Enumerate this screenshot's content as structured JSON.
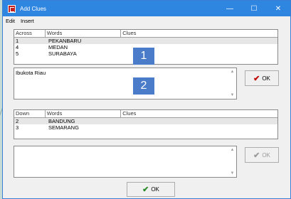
{
  "window": {
    "title": "Add Clues",
    "minimize": "—",
    "maximize": "☐",
    "close": "✕"
  },
  "menu": {
    "edit": "Edit",
    "insert": "Insert"
  },
  "across": {
    "headers": [
      "Across",
      "Words",
      "Clues"
    ],
    "rows": [
      {
        "num": "1",
        "word": "PEKANBARU"
      },
      {
        "num": "4",
        "word": "MEDAN"
      },
      {
        "num": "5",
        "word": "SURABAYA"
      }
    ]
  },
  "across_clue": {
    "text": "Ibukota Riau"
  },
  "down": {
    "headers": [
      "Down",
      "Words",
      "Clues"
    ],
    "rows": [
      {
        "num": "2",
        "word": "BANDUNG"
      },
      {
        "num": "3",
        "word": "SEMARANG"
      }
    ]
  },
  "down_clue": {
    "text": ""
  },
  "buttons": {
    "ok_across": "OK",
    "ok_down": "OK",
    "ok_main": "OK"
  },
  "badges": {
    "b1": "1",
    "b2": "2"
  },
  "colors": {
    "titlebar": "#2f86e0",
    "badge": "#4a7cc9",
    "check_red": "#c00000",
    "check_green": "#2a8a2a"
  }
}
